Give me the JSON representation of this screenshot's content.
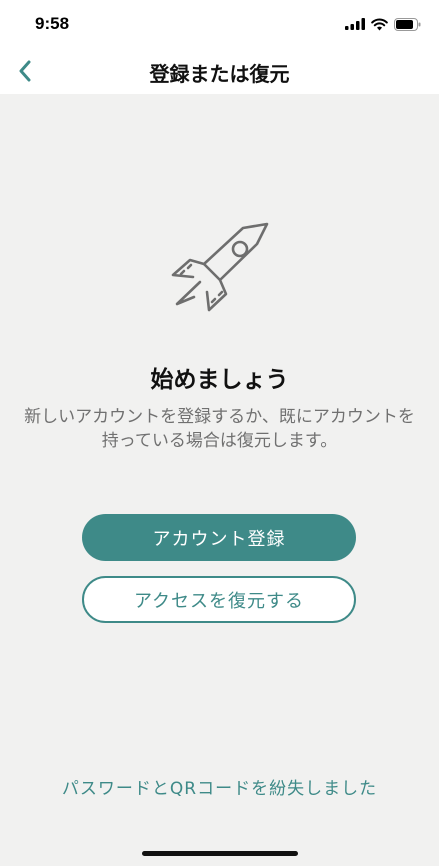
{
  "status_bar": {
    "time": "9:58"
  },
  "nav": {
    "title": "登録または復元",
    "back_icon": "chevron-left-icon"
  },
  "main": {
    "illustration_icon": "rocket-icon",
    "heading": "始めましょう",
    "description": "新しいアカウントを登録するか、既にアカウントを持っている場合は復元します。",
    "register_button": "アカウント登録",
    "restore_button": "アクセスを復元する",
    "lost_link": "パスワードとQRコードを紛失しました"
  },
  "colors": {
    "accent": "#3e8a88",
    "background": "#f1f1f0"
  }
}
